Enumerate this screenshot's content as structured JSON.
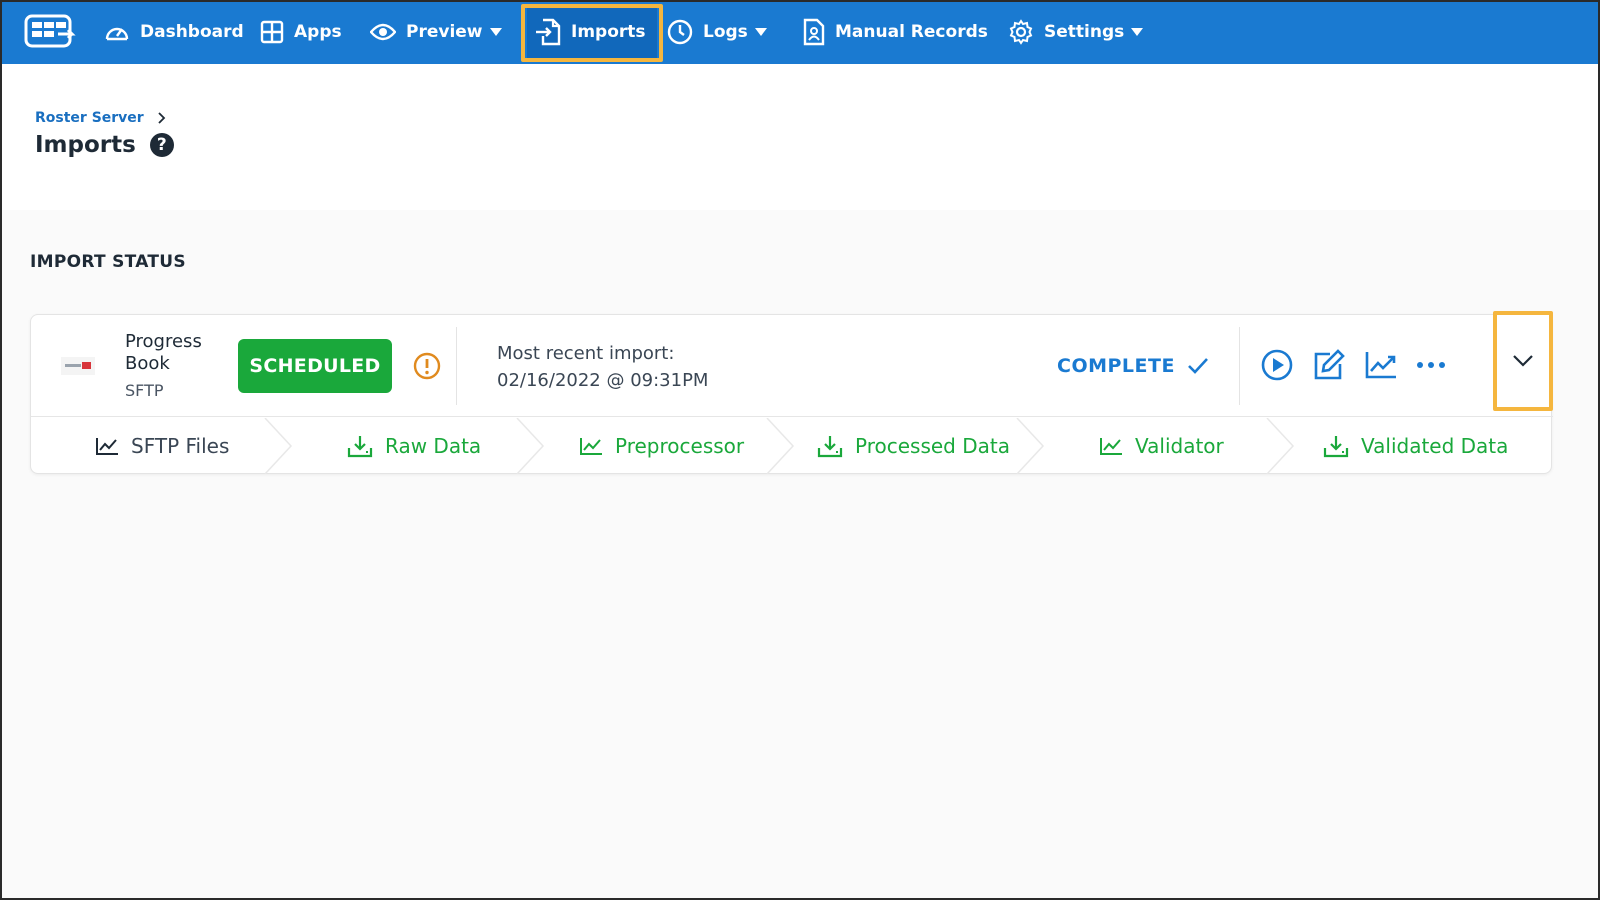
{
  "nav": {
    "items": [
      {
        "label": "Dashboard",
        "icon": "gauge-icon"
      },
      {
        "label": "Apps",
        "icon": "grid-icon"
      },
      {
        "label": "Preview",
        "icon": "eye-icon",
        "has_menu": true
      },
      {
        "label": "Imports",
        "icon": "import-icon",
        "active": true
      },
      {
        "label": "Logs",
        "icon": "clock-icon",
        "has_menu": true
      },
      {
        "label": "Manual Records",
        "icon": "document-user-icon"
      },
      {
        "label": "Settings",
        "icon": "gear-icon",
        "has_menu": true
      }
    ]
  },
  "header": {
    "breadcrumb": "Roster Server",
    "title": "Imports"
  },
  "section": {
    "title": "IMPORT STATUS"
  },
  "import_card": {
    "source_name": "Progress Book",
    "source_type": "SFTP",
    "status": "SCHEDULED",
    "recent_label": "Most recent import:",
    "recent_date": "02/16/2022 @ 09:31PM",
    "result": "COMPLETE",
    "steps": [
      {
        "label": "SFTP Files",
        "icon": "chart-icon"
      },
      {
        "label": "Raw Data",
        "icon": "download-icon"
      },
      {
        "label": "Preprocessor",
        "icon": "chart-icon"
      },
      {
        "label": "Processed Data",
        "icon": "download-icon"
      },
      {
        "label": "Validator",
        "icon": "chart-icon"
      },
      {
        "label": "Validated Data",
        "icon": "download-icon"
      }
    ]
  },
  "colors": {
    "nav_bg": "#1a7ad1",
    "highlight": "#f5b63e",
    "success": "#1aa83b",
    "link": "#1a7ad1",
    "warning": "#e08a1e"
  }
}
